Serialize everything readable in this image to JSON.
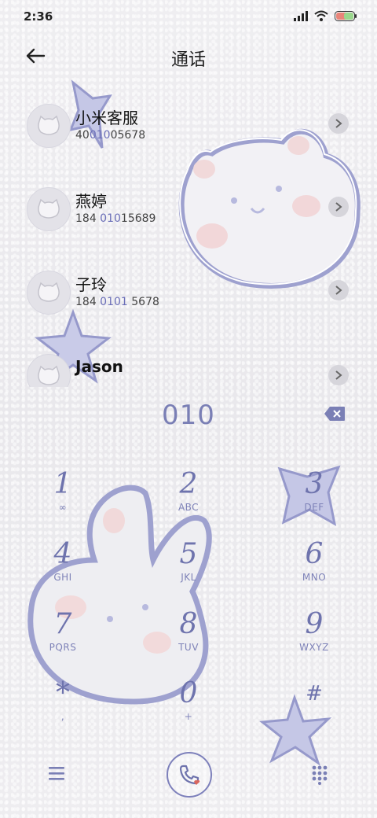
{
  "status_bar": {
    "time": "2:36"
  },
  "header": {
    "title": "通话"
  },
  "contacts": [
    {
      "name": "小米客服",
      "number_parts": [
        "40",
        "010",
        "05678"
      ]
    },
    {
      "name": "燕婷",
      "number_parts": [
        "184 ",
        "010",
        "15689"
      ]
    },
    {
      "name": "子玲",
      "number_parts": [
        "184 ",
        "0101",
        " 5678"
      ]
    },
    {
      "name": "Jason",
      "number_parts": [
        "",
        "",
        ""
      ]
    }
  ],
  "dial": {
    "digits": "010"
  },
  "keypad": [
    {
      "num": "1",
      "letters": "∞"
    },
    {
      "num": "2",
      "letters": "ABC"
    },
    {
      "num": "3",
      "letters": "DEF"
    },
    {
      "num": "4",
      "letters": "GHI"
    },
    {
      "num": "5",
      "letters": "JKL"
    },
    {
      "num": "6",
      "letters": "MNO"
    },
    {
      "num": "7",
      "letters": "PQRS"
    },
    {
      "num": "8",
      "letters": "TUV"
    },
    {
      "num": "9",
      "letters": "WXYZ"
    },
    {
      "num": "*",
      "letters": ","
    },
    {
      "num": "0",
      "letters": "+"
    },
    {
      "num": "#",
      "letters": ""
    }
  ],
  "colors": {
    "accent": "#6e73ad",
    "highlight": "#6b6fb8",
    "background": "#ecebee"
  },
  "icons": {
    "back": "arrow-left-icon",
    "chevron": "chevron-right-icon",
    "delete": "backspace-icon",
    "menu": "menu-icon",
    "call": "phone-icon",
    "keypad": "dialpad-icon"
  }
}
